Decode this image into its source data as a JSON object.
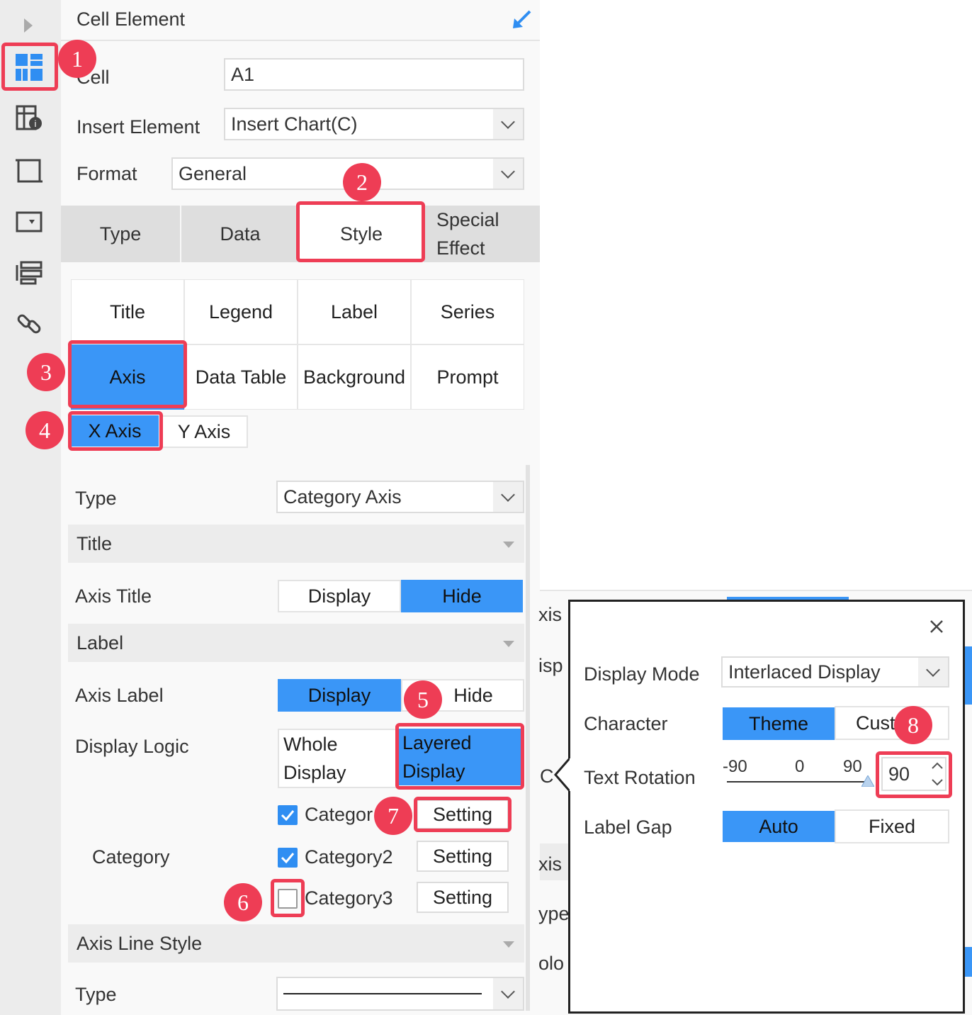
{
  "panel": {
    "header_title": "Cell Element",
    "cell_label": "Cell",
    "cell_value": "A1",
    "insert_label": "Insert Element",
    "insert_value": "Insert Chart(C)",
    "format_label": "Format",
    "format_value": "General"
  },
  "tabs": [
    {
      "label": "Type"
    },
    {
      "label": "Data"
    },
    {
      "label": "Style"
    },
    {
      "label_line1": "Special",
      "label_line2": "Effect"
    }
  ],
  "subtabs": [
    "Title",
    "Legend",
    "Label",
    "Series",
    "Axis",
    "Data Table",
    "Background",
    "Prompt"
  ],
  "axis_tabs": [
    "X Axis",
    "Y Axis"
  ],
  "axis": {
    "type_label": "Type",
    "type_value": "Category Axis",
    "title_section": "Title",
    "axis_title_label": "Axis Title",
    "axis_title_options": [
      "Display",
      "Hide"
    ],
    "label_section": "Label",
    "axis_label_label": "Axis Label",
    "axis_label_options": [
      "Display",
      "Hide"
    ],
    "display_logic_label": "Display Logic",
    "display_logic_opt1_l1": "Whole",
    "display_logic_opt1_l2": "Display",
    "display_logic_opt2_l1": "Layered",
    "display_logic_opt2_l2": "Display",
    "category_label": "Category",
    "categories": [
      {
        "name": "Categor",
        "checked": true,
        "button": "Setting"
      },
      {
        "name": "Category2",
        "checked": true,
        "button": "Setting"
      },
      {
        "name": "Category3",
        "checked": false,
        "button": "Setting"
      }
    ],
    "axis_line_section": "Axis Line Style",
    "line_type_label": "Type"
  },
  "background_fragments": [
    "xis",
    "isp",
    "C",
    "xis",
    "ype",
    "olo"
  ],
  "popup": {
    "display_mode_label": "Display Mode",
    "display_mode_value": "Interlaced Display",
    "character_label": "Character",
    "character_options": [
      "Theme",
      "Cust"
    ],
    "text_rotation_label": "Text Rotation",
    "slider_ticks": [
      "-90",
      "0",
      "90"
    ],
    "rotation_value": "90",
    "label_gap_label": "Label Gap",
    "label_gap_options": [
      "Auto",
      "Fixed"
    ]
  },
  "annotations": [
    "1",
    "2",
    "3",
    "4",
    "5",
    "6",
    "7",
    "8"
  ],
  "colors": {
    "accent": "#3a96f7",
    "highlight": "#ee3d55"
  }
}
